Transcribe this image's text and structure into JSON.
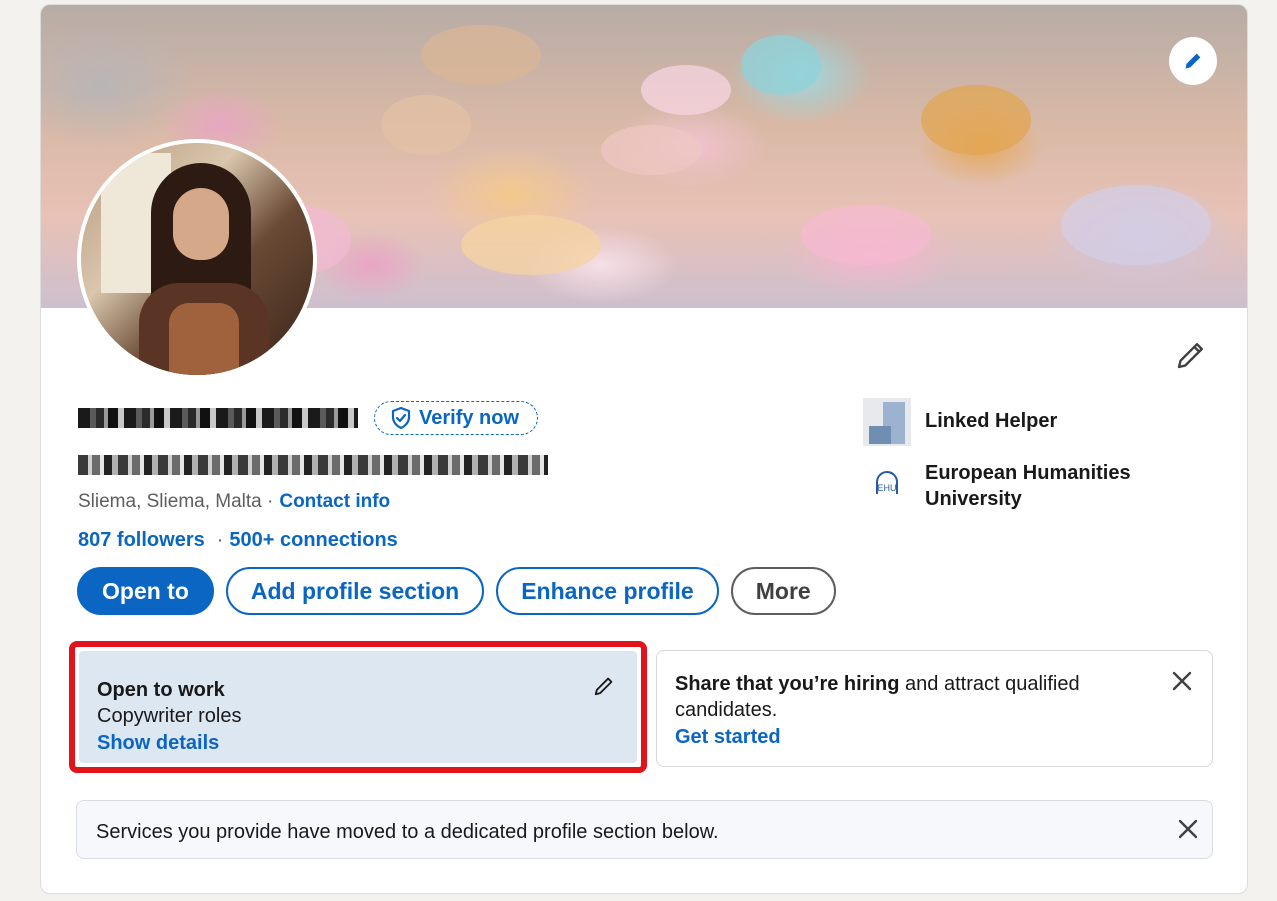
{
  "profile": {
    "verify_label": "Verify now",
    "location": "Sliema, Sliema, Malta ·",
    "contact_info": "Contact info",
    "followers": "807 followers",
    "connections_sep": "·",
    "connections": "500+ connections"
  },
  "actions": {
    "open_to": "Open to",
    "add_section": "Add profile section",
    "enhance": "Enhance profile",
    "more": "More"
  },
  "orgs": [
    {
      "name": "Linked Helper"
    },
    {
      "name": "European Humanities University",
      "logo_text": "EHU"
    }
  ],
  "open_to_work": {
    "title": "Open to work",
    "roles": "Copywriter roles",
    "link": "Show details"
  },
  "hiring": {
    "bold": "Share that you’re hiring",
    "rest": " and attract qualified candidates.",
    "link": "Get started"
  },
  "services_notice": "Services you provide have moved to a dedicated profile section below.",
  "colors": {
    "accent": "#0a66c2",
    "highlight_border": "#e0141a",
    "open_to_work_bg": "#dde7f1"
  }
}
